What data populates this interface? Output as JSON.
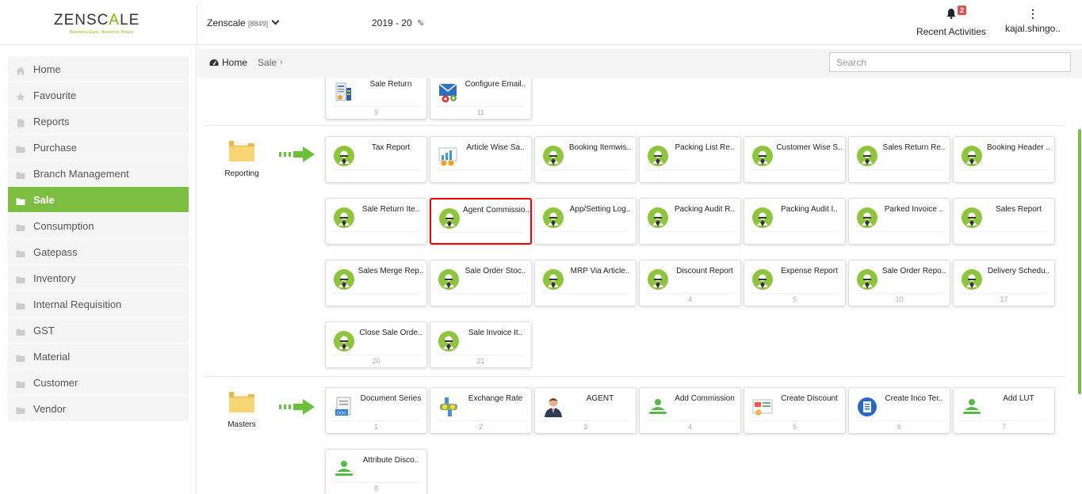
{
  "header": {
    "logo_text": "ZENSCALE",
    "logo_tagline": "Business Ease. Business Peace.",
    "company": "Zenscale",
    "company_code": "[8849]",
    "year": "2019 - 20",
    "notifications_count": "2",
    "activities_label": "Recent Activities",
    "user_label": "kajal.shingo.."
  },
  "sidebar": {
    "items": [
      {
        "label": "Home",
        "icon": "home-icon"
      },
      {
        "label": "Favourite",
        "icon": "star-icon"
      },
      {
        "label": "Reports",
        "icon": "file-icon"
      },
      {
        "label": "Purchase",
        "icon": "folder-icon"
      },
      {
        "label": "Branch Management",
        "icon": "folder-icon"
      },
      {
        "label": "Sale",
        "icon": "folder-icon",
        "active": true
      },
      {
        "label": "Consumption",
        "icon": "folder-icon"
      },
      {
        "label": "Gatepass",
        "icon": "folder-icon"
      },
      {
        "label": "Inventory",
        "icon": "folder-icon"
      },
      {
        "label": "Internal Requisition",
        "icon": "folder-icon"
      },
      {
        "label": "GST",
        "icon": "folder-icon"
      },
      {
        "label": "Material",
        "icon": "folder-icon"
      },
      {
        "label": "Customer",
        "icon": "folder-icon"
      },
      {
        "label": "Vendor",
        "icon": "folder-icon"
      }
    ]
  },
  "breadcrumb": {
    "home": "Home",
    "current": "Sale"
  },
  "search": {
    "placeholder": "Search"
  },
  "top_tiles": [
    {
      "name": "Sale Return",
      "count": "9"
    },
    {
      "name": "Configure Email..",
      "count": "11"
    }
  ],
  "reporting": {
    "label": "Reporting",
    "tiles": [
      {
        "name": "Tax Report",
        "count": ""
      },
      {
        "name": "Article Wise Sa..",
        "count": ""
      },
      {
        "name": "Booking Itemwis..",
        "count": ""
      },
      {
        "name": "Packing List Re..",
        "count": ""
      },
      {
        "name": "Customer Wise S..",
        "count": ""
      },
      {
        "name": "Sales Return Re..",
        "count": ""
      },
      {
        "name": "Booking Header ..",
        "count": ""
      },
      {
        "name": "Sale Return Ite..",
        "count": ""
      },
      {
        "name": "Agent Commissio..",
        "count": ""
      },
      {
        "name": "App/Setting Log..",
        "count": ""
      },
      {
        "name": "Packing Audit R..",
        "count": ""
      },
      {
        "name": "Packing Audit I..",
        "count": ""
      },
      {
        "name": "Parked Invoice ..",
        "count": ""
      },
      {
        "name": "Sales Report",
        "count": ""
      },
      {
        "name": "Sales Merge Rep..",
        "count": ""
      },
      {
        "name": "Sale Order Stoc..",
        "count": ""
      },
      {
        "name": "MRP Via Article..",
        "count": ""
      },
      {
        "name": "Discount Report",
        "count": "4"
      },
      {
        "name": "Expense Report",
        "count": "5"
      },
      {
        "name": "Sale Order Repo..",
        "count": "10"
      },
      {
        "name": "Delivery Schedu..",
        "count": "17"
      },
      {
        "name": "Close Sale Orde..",
        "count": "20"
      },
      {
        "name": "Sale Invoice It..",
        "count": "21"
      }
    ]
  },
  "masters": {
    "label": "Masters",
    "tiles": [
      {
        "name": "Document Series",
        "count": "1"
      },
      {
        "name": "Exchange Rate",
        "count": "2"
      },
      {
        "name": "AGENT",
        "count": "3"
      },
      {
        "name": "Add Commission",
        "count": "4"
      },
      {
        "name": "Create Discount",
        "count": "5"
      },
      {
        "name": "Create Inco Ter..",
        "count": "6"
      },
      {
        "name": "Add LUT",
        "count": "7"
      },
      {
        "name": "Attribute Disco..",
        "count": "8"
      }
    ]
  },
  "colors": {
    "accent": "#7cbd42",
    "highlight": "#ee0000"
  }
}
